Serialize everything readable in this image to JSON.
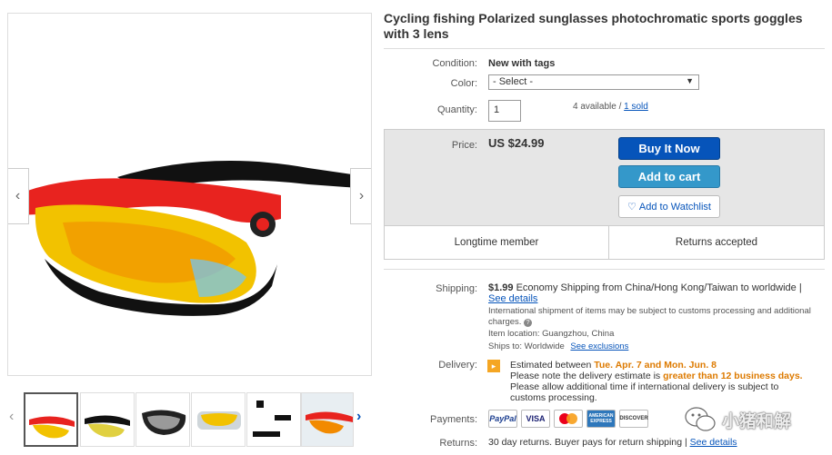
{
  "listing": {
    "title": "Cycling fishing Polarized sunglasses photochromatic sports goggles with 3 lens"
  },
  "condition": {
    "label": "Condition:",
    "value": "New with tags"
  },
  "color": {
    "label": "Color:",
    "selected": "- Select -"
  },
  "quantity": {
    "label": "Quantity:",
    "value": "1",
    "available": "4 available /",
    "sold_link": "1 sold"
  },
  "price": {
    "label": "Price:",
    "value": "US $24.99"
  },
  "actions": {
    "buy_now": "Buy It Now",
    "add_to_cart": "Add to cart",
    "watchlist": "Add to Watchlist"
  },
  "seller_badges": [
    "Longtime member",
    "Returns accepted"
  ],
  "shipping": {
    "label": "Shipping:",
    "cost": "$1.99",
    "method": "Economy Shipping from China/Hong Kong/Taiwan to worldwide |",
    "details_link": "See details",
    "intl_note": "International shipment of items may be subject to customs processing and additional charges.",
    "item_location": "Item location:  Guangzhou, China",
    "ships_to": "Ships to:  Worldwide",
    "exclusions_link": "See exclusions"
  },
  "delivery": {
    "label": "Delivery:",
    "estimated_prefix": "Estimated between",
    "estimated_dates": "Tue. Apr. 7 and Mon. Jun. 8",
    "note_prefix": "Please note the delivery estimate is",
    "note_highlight": "greater than 12 business days.",
    "note_line3": "Please allow additional time if international delivery is subject to",
    "note_line4": "customs processing."
  },
  "payments": {
    "label": "Payments:",
    "icons": [
      "PayPal",
      "VISA",
      "mastercard-icon",
      "AMERICAN EXPRESS",
      "DISCOVER"
    ]
  },
  "returns": {
    "label": "Returns:",
    "text": "30 day returns. Buyer pays for return shipping |",
    "details_link": "See details"
  },
  "watermark": {
    "text": "小猪和解"
  },
  "colors": {
    "buy_now": "#0654ba",
    "add_to_cart": "#3498ca",
    "link": "#0654ba",
    "highlight": "#dd7a00",
    "goggle_frame": "#e8231f",
    "lens": "#f2c200"
  }
}
